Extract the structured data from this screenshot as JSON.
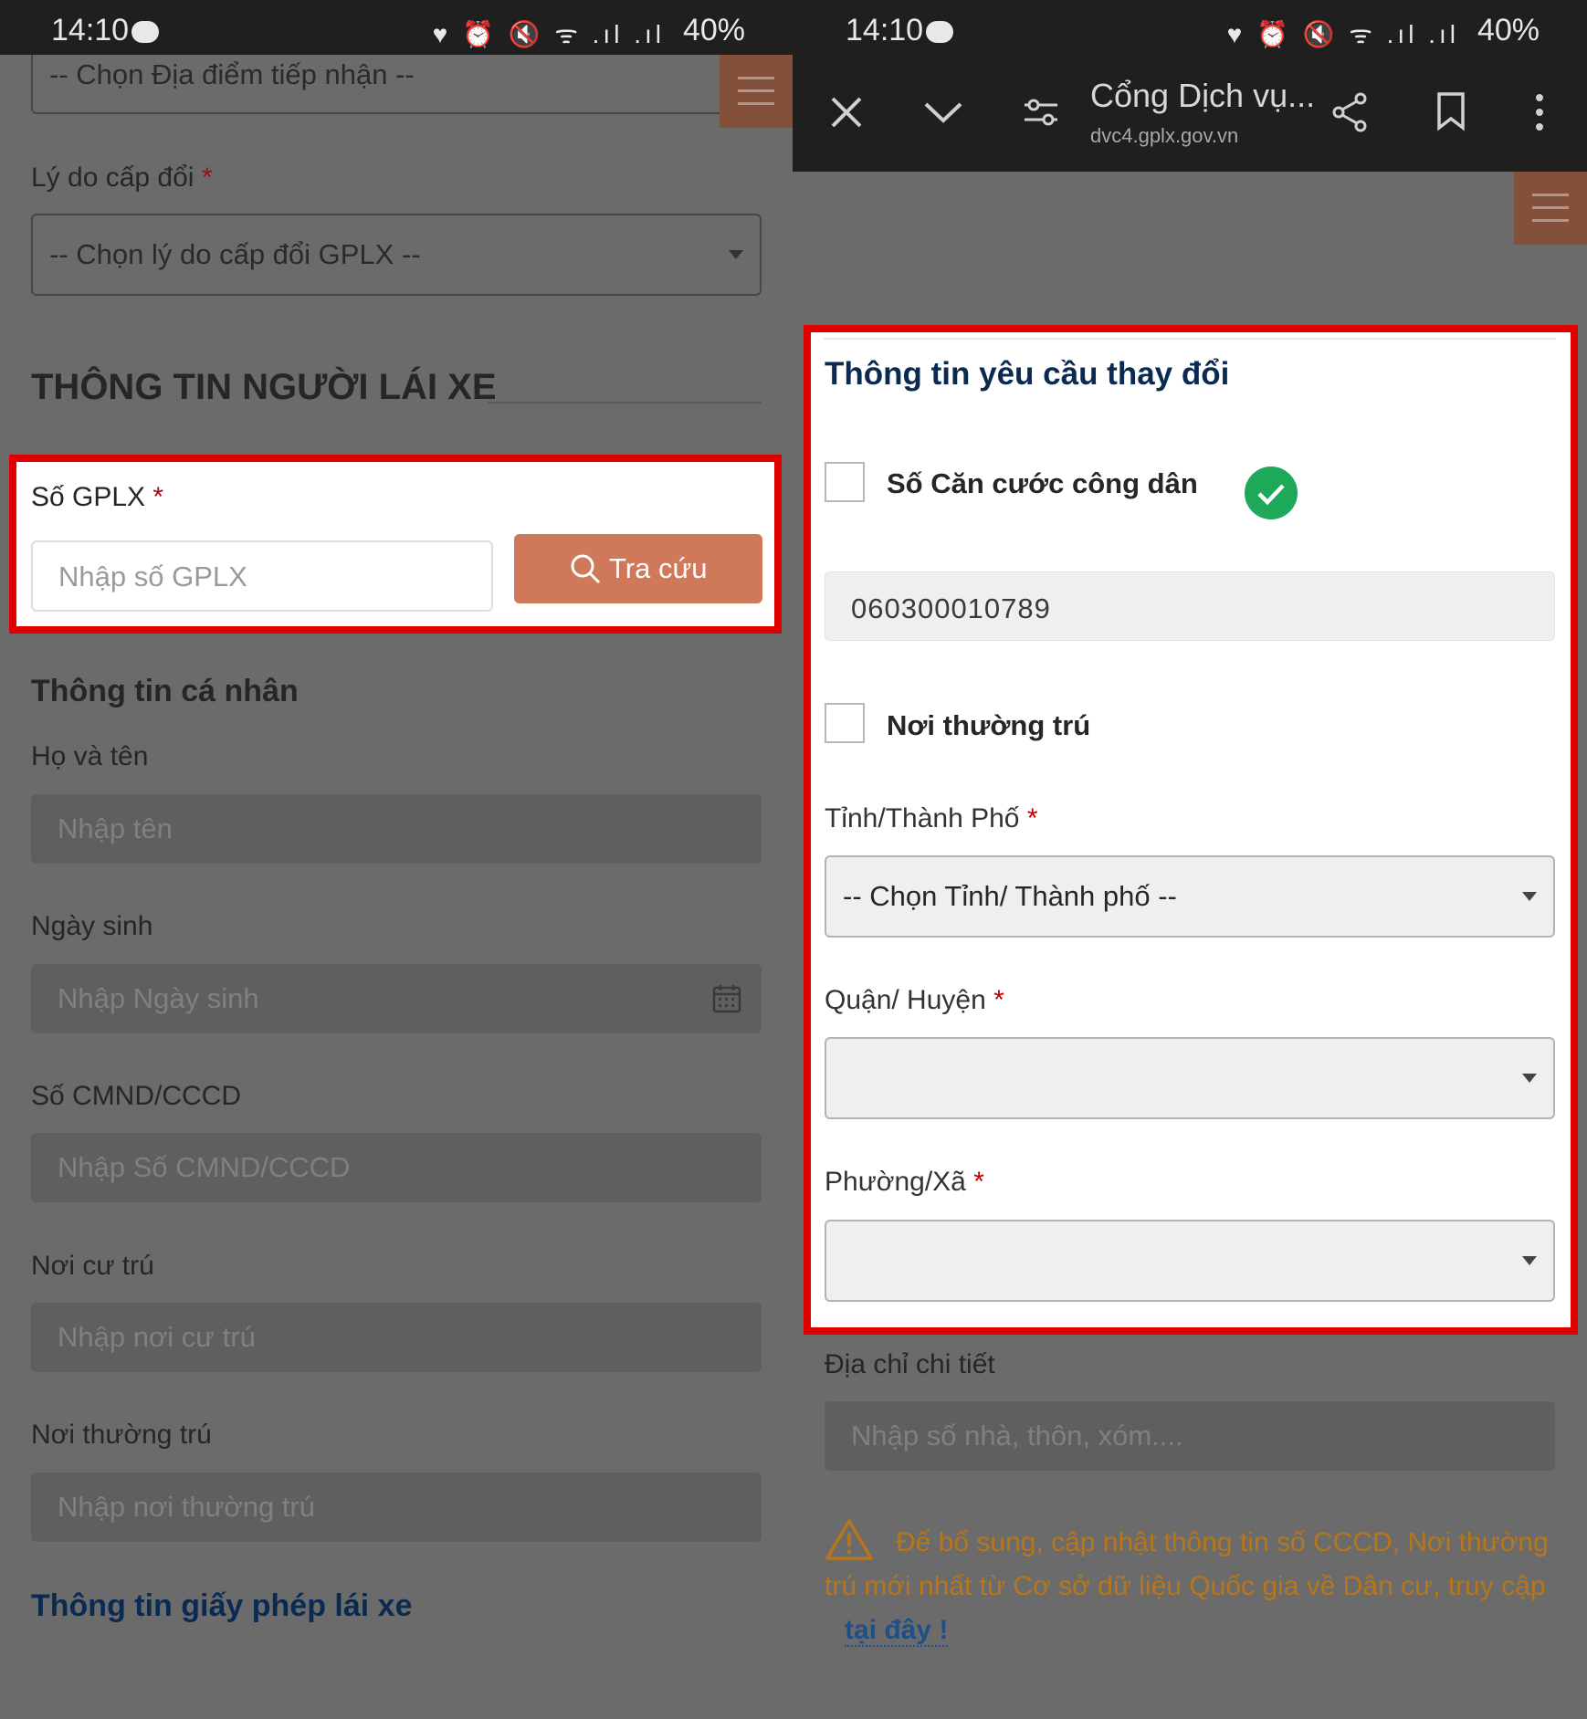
{
  "left": {
    "status": {
      "time": "14:10",
      "icons": "♥ ⏰ 🔇 ᯤ .ıl .ıl",
      "battery": "40%"
    },
    "top_select_placeholder": "-- Chọn Địa điểm tiếp nhận --",
    "reason_label": "Lý do cấp đổi",
    "reason_placeholder": "-- Chọn lý do cấp đổi GPLX --",
    "section_title": "THÔNG TIN NGƯỜI LÁI XE",
    "license": {
      "label": "Số GPLX",
      "placeholder": "Nhập số GPLX",
      "button": "Tra cứu"
    },
    "personal_title": "Thông tin cá nhân",
    "fields": [
      {
        "label": "Họ và tên",
        "placeholder": "Nhập tên"
      },
      {
        "label": "Ngày sinh",
        "placeholder": "Nhập Ngày sinh"
      },
      {
        "label": "Số CMND/CCCD",
        "placeholder": "Nhập Số CMND/CCCD"
      },
      {
        "label": "Nơi cư trú",
        "placeholder": "Nhập nơi cư trú"
      },
      {
        "label": "Nơi thường trú",
        "placeholder": "Nhập nơi thường trú"
      }
    ],
    "license_info_title": "Thông tin giấy phép lái xe"
  },
  "right": {
    "status": {
      "time": "14:10",
      "icons": "♥ ⏰ 🔇 ᯤ .ıl .ıl",
      "battery": "40%"
    },
    "browser": {
      "title": "Cổng Dịch vụ...",
      "url": "dvc4.gplx.gov.vn"
    },
    "change_title": "Thông tin yêu cầu thay đổi",
    "cccd_label": "Số Căn cước công dân",
    "cccd_value": "060300010789",
    "residence_label": "Nơi thường trú",
    "province_label": "Tỉnh/Thành Phố",
    "province_placeholder": "-- Chọn Tỉnh/ Thành phố --",
    "district_label": "Quận/ Huyện",
    "ward_label": "Phường/Xã",
    "address_label": "Địa chỉ chi tiết",
    "address_placeholder": "Nhập số nhà, thôn, xóm....",
    "warning_text": "Để bổ sung, cập nhật thông tin số CCCD, Nơi thường trú mới nhất từ Cơ sở dữ liệu Quốc gia về Dân cư, truy cập",
    "warning_link": "tại đây !",
    "colors": {
      "accent": "#d0785a",
      "red_highlight": "#e00000",
      "success": "#1ea85a",
      "warning": "#b8761a"
    }
  },
  "required_mark": "*"
}
